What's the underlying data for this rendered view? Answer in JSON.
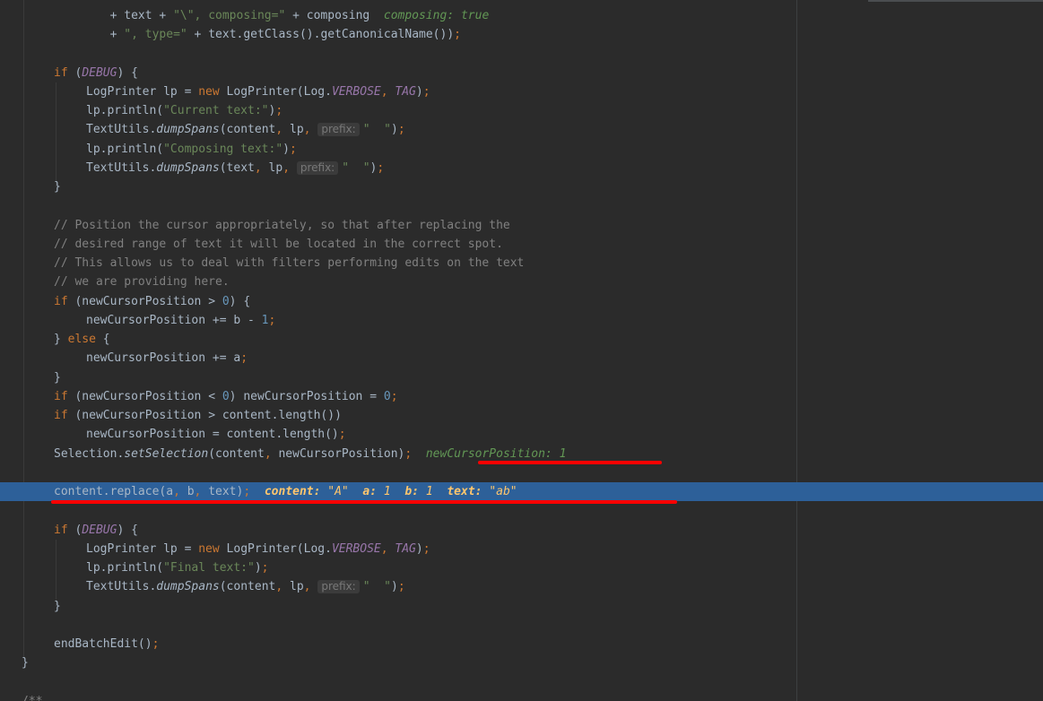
{
  "lines": {
    "l1": {
      "a": "        + text + ",
      "s1": "\"\\\", composing=\"",
      "b": " + composing  ",
      "v": "composing: true"
    },
    "l2": {
      "a": "        + ",
      "s1": "\", type=\"",
      "b": " + text.getClass().getCanonicalName())",
      "semi": ";"
    },
    "l3": {
      "kw": "if",
      "a": " (",
      "c": "DEBUG",
      "b": ") {"
    },
    "l4": {
      "a": "LogPrinter lp = ",
      "kw": "new",
      "b": " LogPrinter(Log.",
      "c1": "VERBOSE",
      "comma": ", ",
      "c2": "TAG",
      "e": ")",
      "semi": ";"
    },
    "l5": {
      "a": "lp.println(",
      "s": "\"Current text:\"",
      "e": ")",
      "semi": ";"
    },
    "l6": {
      "a": "TextUtils.",
      "m": "dumpSpans",
      "b": "(content",
      "comma1": ",",
      "c": " lp",
      "comma2": ", ",
      "hint": "prefix:",
      "s": "\"  \"",
      "e": ")",
      "semi": ";"
    },
    "l7": {
      "a": "lp.println(",
      "s": "\"Composing text:\"",
      "e": ")",
      "semi": ";"
    },
    "l8": {
      "a": "TextUtils.",
      "m": "dumpSpans",
      "b": "(text",
      "comma1": ",",
      "c": " lp",
      "comma2": ", ",
      "hint": "prefix:",
      "s": "\"  \"",
      "e": ")",
      "semi": ";"
    },
    "l9": {
      "a": "}"
    },
    "c1": "// Position the cursor appropriately, so that after replacing the",
    "c2": "// desired range of text it will be located in the correct spot.",
    "c3": "// This allows us to deal with filters performing edits on the text",
    "c4": "// we are providing here.",
    "l10": {
      "kw": "if",
      "a": " (newCursorPosition > ",
      "n": "0",
      "b": ") {"
    },
    "l11": {
      "a": "newCursorPosition += b - ",
      "n": "1",
      "semi": ";"
    },
    "l12": {
      "a": "} ",
      "kw": "else",
      "b": " {"
    },
    "l13": {
      "a": "newCursorPosition += a",
      "semi": ";"
    },
    "l14": {
      "a": "}"
    },
    "l15": {
      "kw": "if",
      "a": " (newCursorPosition < ",
      "n1": "0",
      "b": ") newCursorPosition = ",
      "n2": "0",
      "semi": ";"
    },
    "l16": {
      "kw": "if",
      "a": " (newCursorPosition > content.length())"
    },
    "l17": {
      "a": "newCursorPosition = content.length()",
      "semi": ";"
    },
    "l18": {
      "a": "Selection.",
      "m": "setSelection",
      "b": "(content",
      "comma": ",",
      "c": " newCursorPosition)",
      "semi": ";",
      "v": "newCursorPosition: 1"
    },
    "l19": {
      "a": "content.replace(a",
      "comma1": ",",
      "b": " b",
      "comma2": ",",
      "c": " text)",
      "semi": ";",
      "d1n": "content:",
      "d1v": "\"A\"",
      "d2n": "a:",
      "d2v": "1",
      "d3n": "b:",
      "d3v": "1",
      "d4n": "text:",
      "d4v": "\"ab\""
    },
    "l20": {
      "kw": "if",
      "a": " (",
      "c": "DEBUG",
      "b": ") {"
    },
    "l21": {
      "a": "LogPrinter lp = ",
      "kw": "new",
      "b": " LogPrinter(Log.",
      "c1": "VERBOSE",
      "comma": ", ",
      "c2": "TAG",
      "e": ")",
      "semi": ";"
    },
    "l22": {
      "a": "lp.println(",
      "s": "\"Final text:\"",
      "e": ")",
      "semi": ";"
    },
    "l23": {
      "a": "TextUtils.",
      "m": "dumpSpans",
      "b": "(content",
      "comma1": ",",
      "c": " lp",
      "comma2": ", ",
      "hint": "prefix:",
      "s": "\"  \"",
      "e": ")",
      "semi": ";"
    },
    "l24": {
      "a": "}"
    },
    "l25": {
      "a": "endBatchEdit()",
      "semi": ";"
    },
    "l26": {
      "a": "}"
    },
    "l27": {
      "a": "/**"
    }
  },
  "colors": {
    "background": "#2b2b2b",
    "execution_line": "#2d6099",
    "keyword": "#cc7832",
    "string": "#6a8759",
    "number": "#6897bb",
    "constant": "#9876aa",
    "comment": "#808080",
    "inline_value": "#629755",
    "annotation_red": "#ff0000"
  }
}
